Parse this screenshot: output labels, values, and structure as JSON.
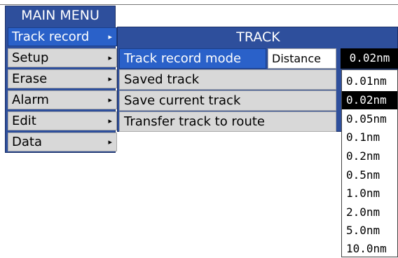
{
  "main_menu": {
    "title": "MAIN MENU",
    "items": [
      {
        "label": "Track record",
        "arrow": "▸"
      },
      {
        "label": "Setup",
        "arrow": "▸"
      },
      {
        "label": "Erase",
        "arrow": "▸"
      },
      {
        "label": "Alarm",
        "arrow": "▸"
      },
      {
        "label": "Edit",
        "arrow": "▸"
      },
      {
        "label": "Data",
        "arrow": "▸"
      }
    ]
  },
  "track_menu": {
    "title": "TRACK",
    "items": [
      {
        "label": "Track record mode"
      },
      {
        "label": "Saved track"
      },
      {
        "label": "Save current track"
      },
      {
        "label": "Transfer track to route"
      }
    ],
    "mode_value": "Distance",
    "distance_value": "0.02nm"
  },
  "dropdown": {
    "options": [
      "0.01nm",
      "0.02nm",
      "0.05nm",
      "0.1nm",
      "0.2nm",
      "0.5nm",
      "1.0nm",
      "2.0nm",
      "5.0nm",
      "10.0nm"
    ],
    "selected": "0.02nm"
  },
  "colors": {
    "menu_blue": "#2e4f9c",
    "highlight_blue": "#2a61c9",
    "item_gray": "#d8d8d8",
    "selected_black": "#000000"
  }
}
